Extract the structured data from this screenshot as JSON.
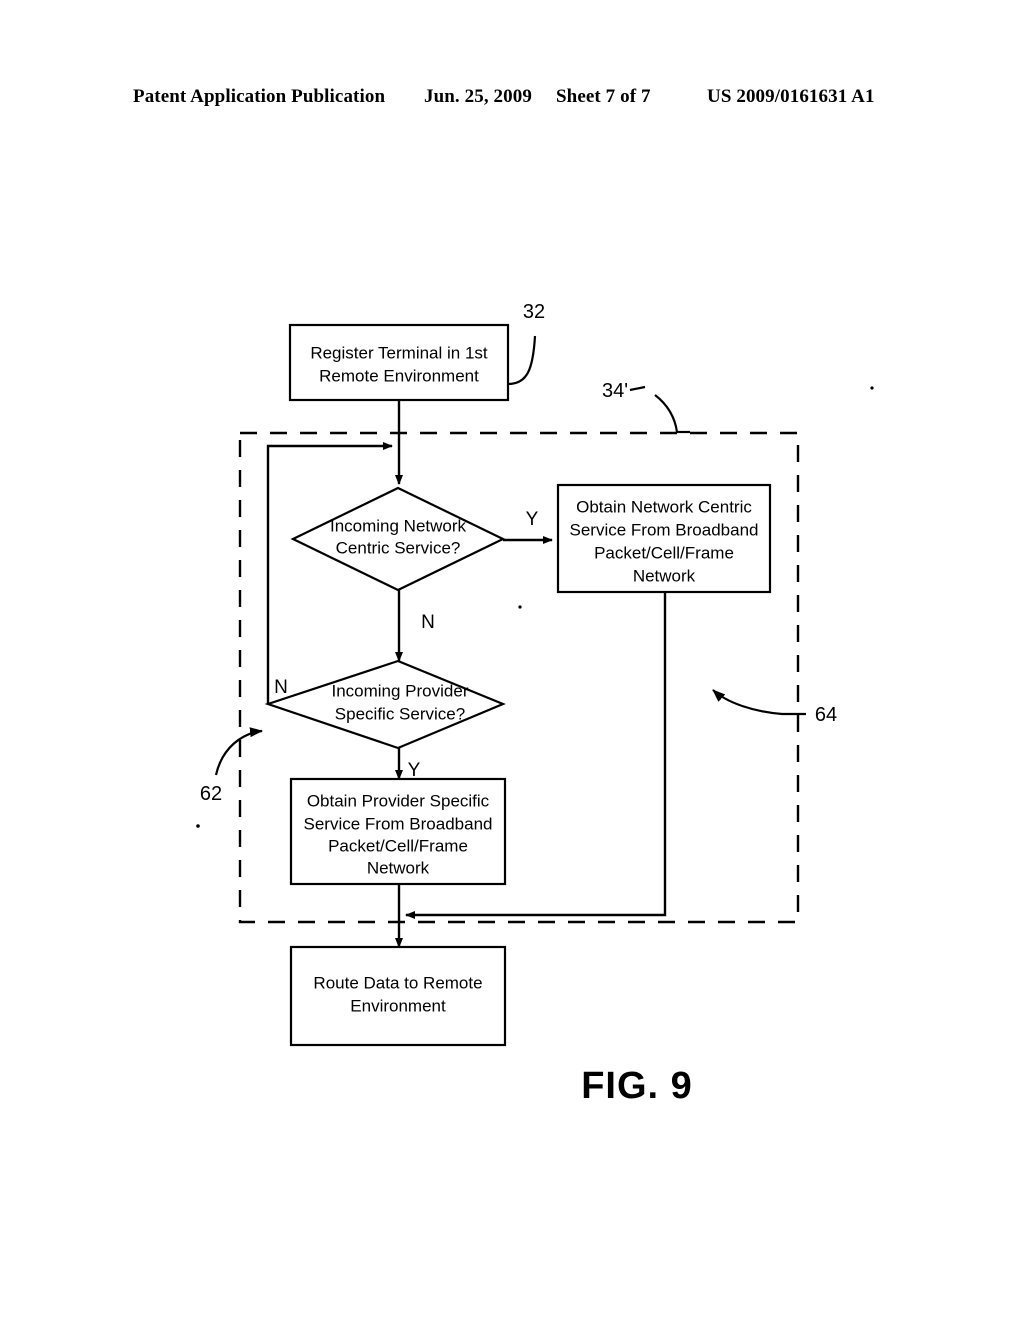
{
  "header": {
    "publication": "Patent Application Publication",
    "date": "Jun. 25, 2009",
    "sheet": "Sheet 7 of 7",
    "patent_number": "US 2009/0161631 A1"
  },
  "figure": {
    "caption": "FIG. 9",
    "nodes": {
      "register": {
        "type": "process",
        "lines": [
          "Register Terminal in 1st",
          "Remote Environment"
        ]
      },
      "decision_network_centric": {
        "type": "decision",
        "lines": [
          "Incoming Network",
          "Centric Service?"
        ]
      },
      "obtain_network_centric": {
        "type": "process",
        "lines": [
          "Obtain Network Centric",
          "Service From Broadband",
          "Packet/Cell/Frame",
          "Network"
        ]
      },
      "decision_provider_specific": {
        "type": "decision",
        "lines": [
          "Incoming Provider",
          "Specific Service?"
        ]
      },
      "obtain_provider_specific": {
        "type": "process",
        "lines": [
          "Obtain Provider Specific",
          "Service From Broadband",
          "Packet/Cell/Frame",
          "Network"
        ]
      },
      "route_data": {
        "type": "process",
        "lines": [
          "Route Data to Remote",
          "Environment"
        ]
      }
    },
    "branch_labels": {
      "network_centric_yes": "Y",
      "network_centric_no": "N",
      "provider_specific_no": "N",
      "provider_specific_yes": "Y"
    },
    "reference_numerals": {
      "register_block": "32",
      "region_top": "34'",
      "loop_back": "62",
      "region_right": "64"
    }
  },
  "colors": {
    "ink": "#000000",
    "paper": "#ffffff"
  }
}
